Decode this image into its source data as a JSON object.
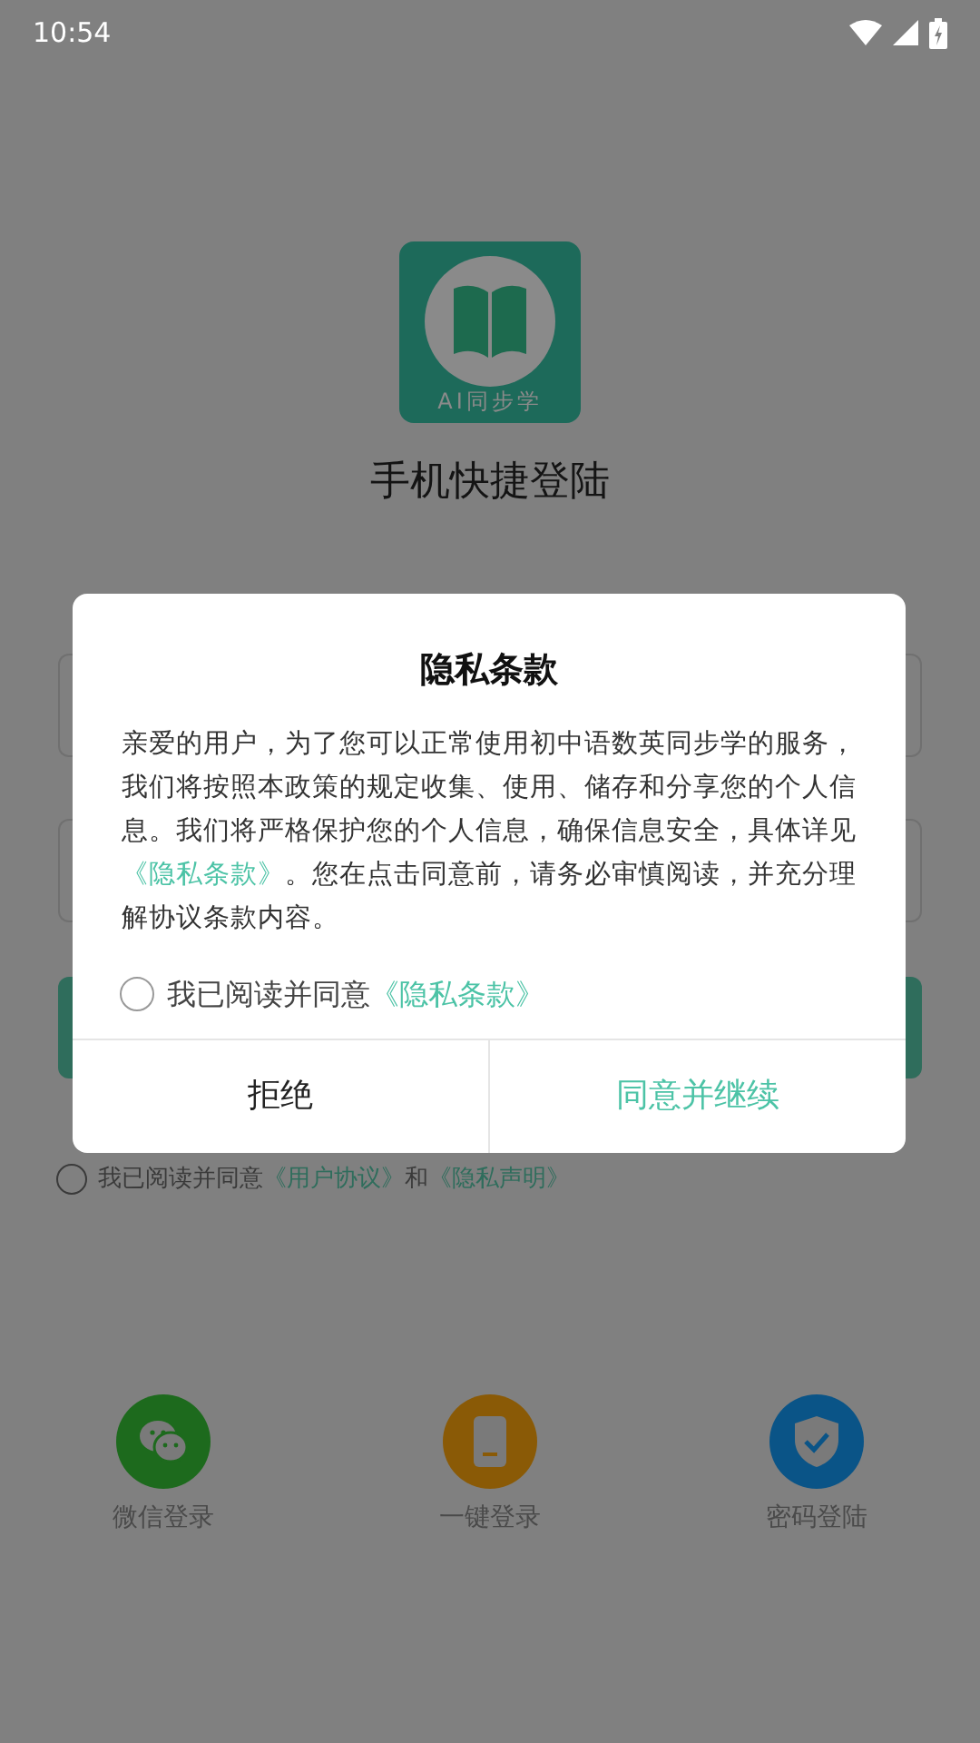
{
  "status_bar": {
    "time": "10:54"
  },
  "login_page": {
    "logo_text": "AI同步学",
    "title": "手机快捷登陆",
    "agreement": {
      "checked": false,
      "before": "我已阅读并同意",
      "link1": "《用户协议》",
      "middle": "和",
      "link2": "《隐私声明》"
    },
    "options": [
      {
        "label": "微信登录",
        "kind": "wechat",
        "color": "#1d6a1d"
      },
      {
        "label": "一键登录",
        "kind": "phone",
        "color": "#8a5a06"
      },
      {
        "label": "密码登陆",
        "kind": "shield",
        "color": "#0a5487"
      }
    ]
  },
  "dialog": {
    "title": "隐私条款",
    "body_before": "亲爱的用户，为了您可以正常使用初中语数英同步学的服务，我们将按照本政策的规定收集、使用、储存和分享您的个人信息。我们将严格保护您的个人信息，确保信息安全，具体详见",
    "body_link": "《隐私条款》",
    "body_after": "。您在点击同意前，请务必审慎阅读，并充分理解协议条款内容。",
    "consent": {
      "checked": false,
      "label": "我已阅读并同意",
      "link": "《隐私条款》"
    },
    "buttons": [
      {
        "label": "拒绝",
        "kind": "decline"
      },
      {
        "label": "同意并继续",
        "kind": "accept"
      }
    ]
  }
}
